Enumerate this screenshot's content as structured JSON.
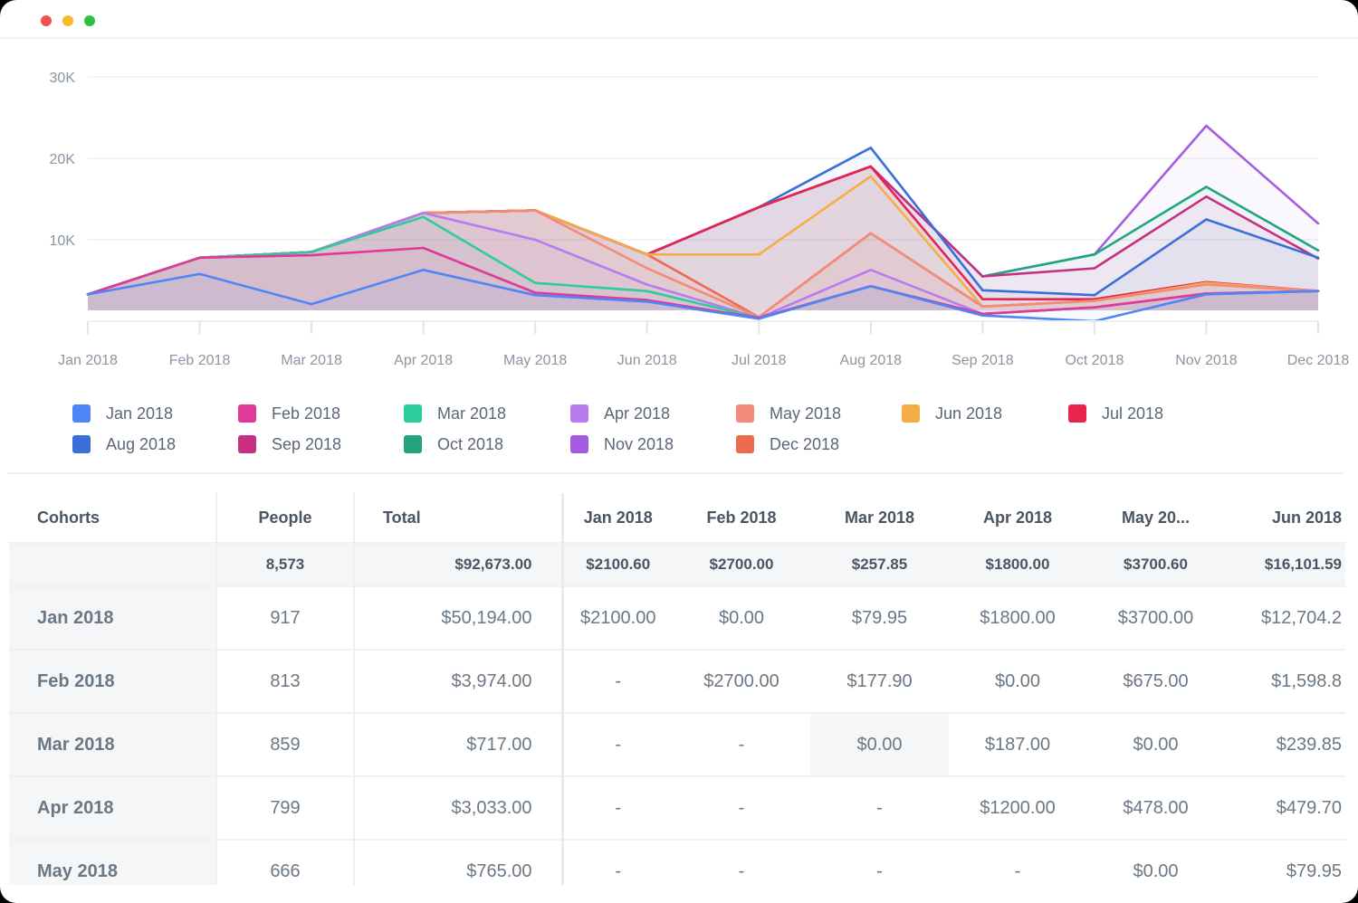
{
  "window": {
    "controls": [
      "close",
      "minimize",
      "maximize"
    ]
  },
  "chart_data": {
    "type": "line",
    "title": "",
    "xlabel": "",
    "ylabel": "",
    "ylim": [
      0,
      30000
    ],
    "yticks": [
      {
        "value": 10000,
        "label": "10K"
      },
      {
        "value": 20000,
        "label": "20K"
      },
      {
        "value": 30000,
        "label": "30K"
      }
    ],
    "grid": true,
    "legend_position": "bottom",
    "categories": [
      "Jan 2018",
      "Feb 2018",
      "Mar 2018",
      "Apr 2018",
      "May 2018",
      "Jun 2018",
      "Jul 2018",
      "Aug 2018",
      "Sep 2018",
      "Oct 2018",
      "Nov 2018",
      "Dec 2018"
    ],
    "series": [
      {
        "name": "Jan 2018",
        "color": "#4f86f7",
        "values": [
          3300,
          5800,
          2100,
          6300,
          3200,
          2400,
          300,
          4300,
          700,
          0,
          3300,
          3700
        ]
      },
      {
        "name": "Feb 2018",
        "color": "#e0399a",
        "values": [
          3300,
          7800,
          8100,
          9000,
          3500,
          2600,
          400,
          4300,
          900,
          1700,
          3400,
          3700
        ]
      },
      {
        "name": "Mar 2018",
        "color": "#2ecc9a",
        "values": [
          3300,
          7800,
          8500,
          12800,
          4700,
          3700,
          400,
          4300,
          900,
          1700,
          3400,
          3700
        ]
      },
      {
        "name": "Apr 2018",
        "color": "#b67cf0",
        "values": [
          3300,
          7800,
          8500,
          13300,
          10000,
          4500,
          400,
          6300,
          900,
          1700,
          3400,
          3700
        ]
      },
      {
        "name": "May 2018",
        "color": "#f28b78",
        "values": [
          3300,
          7800,
          8500,
          13300,
          13600,
          6500,
          500,
          10800,
          1800,
          2500,
          4500,
          3700
        ]
      },
      {
        "name": "Jun 2018",
        "color": "#f5ae45",
        "values": [
          3300,
          7800,
          8500,
          13300,
          13600,
          8200,
          8200,
          17800,
          1800,
          2500,
          4700,
          3700
        ]
      },
      {
        "name": "Jul 2018",
        "color": "#e8244e",
        "values": [
          3300,
          7800,
          8500,
          13300,
          13600,
          8200,
          14000,
          19000,
          2700,
          2700,
          4800,
          3700
        ]
      },
      {
        "name": "Aug 2018",
        "color": "#3b6fd8",
        "values": [
          3300,
          7800,
          8500,
          13300,
          13600,
          8200,
          14000,
          21300,
          3800,
          3200,
          12500,
          7800
        ]
      },
      {
        "name": "Sep 2018",
        "color": "#c72f82",
        "values": [
          3300,
          7800,
          8500,
          13300,
          13600,
          8200,
          14000,
          19000,
          5500,
          6500,
          15300,
          7700
        ]
      },
      {
        "name": "Oct 2018",
        "color": "#20a57e",
        "values": [
          3300,
          7800,
          8500,
          13300,
          13600,
          8200,
          14000,
          19000,
          5500,
          8200,
          16500,
          8700
        ]
      },
      {
        "name": "Nov 2018",
        "color": "#a45de0",
        "values": [
          3300,
          7800,
          8500,
          13300,
          13600,
          8200,
          14000,
          19000,
          5500,
          8200,
          24000,
          12000
        ]
      },
      {
        "name": "Dec 2018",
        "color": "#ec6a4e",
        "values": [
          3300,
          7800,
          8500,
          13300,
          13600,
          8200,
          500,
          10800,
          1800,
          2500,
          4600,
          3700
        ]
      }
    ]
  },
  "legend": {
    "items": [
      {
        "label": "Jan 2018",
        "color": "#4f86f7"
      },
      {
        "label": "Feb 2018",
        "color": "#e0399a"
      },
      {
        "label": "Mar 2018",
        "color": "#2ecc9a"
      },
      {
        "label": "Apr 2018",
        "color": "#b67cf0"
      },
      {
        "label": "May 2018",
        "color": "#f28b78"
      },
      {
        "label": "Jun 2018",
        "color": "#f5ae45"
      },
      {
        "label": "Jul 2018",
        "color": "#e8244e"
      },
      {
        "label": "Aug 2018",
        "color": "#3b6fd8"
      },
      {
        "label": "Sep 2018",
        "color": "#c72f82"
      },
      {
        "label": "Oct 2018",
        "color": "#20a57e"
      },
      {
        "label": "Nov 2018",
        "color": "#a45de0"
      },
      {
        "label": "Dec 2018",
        "color": "#ec6a4e"
      }
    ]
  },
  "table": {
    "headers": {
      "cohorts": "Cohorts",
      "people": "People",
      "total": "Total",
      "months": [
        "Jan 2018",
        "Feb 2018",
        "Mar 2018",
        "Apr 2018",
        "May 20...",
        "Jun 2018"
      ]
    },
    "totals": {
      "cohort": "",
      "people": "8,573",
      "total": "$92,673.00",
      "months": [
        "$2100.60",
        "$2700.00",
        "$257.85",
        "$1800.00",
        "$3700.60",
        "$16,101.59"
      ]
    },
    "rows": [
      {
        "cohort": "Jan 2018",
        "people": "917",
        "total": "$50,194.00",
        "months": [
          "$2100.00",
          "$0.00",
          "$79.95",
          "$1800.00",
          "$3700.00",
          "$12,704.2"
        ]
      },
      {
        "cohort": "Feb 2018",
        "people": "813",
        "total": "$3,974.00",
        "months": [
          "-",
          "$2700.00",
          "$177.90",
          "$0.00",
          "$675.00",
          "$1,598.8"
        ]
      },
      {
        "cohort": "Mar 2018",
        "people": "859",
        "total": "$717.00",
        "months": [
          "-",
          "-",
          "$0.00",
          "$187.00",
          "$0.00",
          "$239.85"
        ]
      },
      {
        "cohort": "Apr 2018",
        "people": "799",
        "total": "$3,033.00",
        "months": [
          "-",
          "-",
          "-",
          "$1200.00",
          "$478.00",
          "$479.70"
        ]
      },
      {
        "cohort": "May 2018",
        "people": "666",
        "total": "$765.00",
        "months": [
          "-",
          "-",
          "-",
          "-",
          "$0.00",
          "$79.95"
        ]
      }
    ]
  }
}
